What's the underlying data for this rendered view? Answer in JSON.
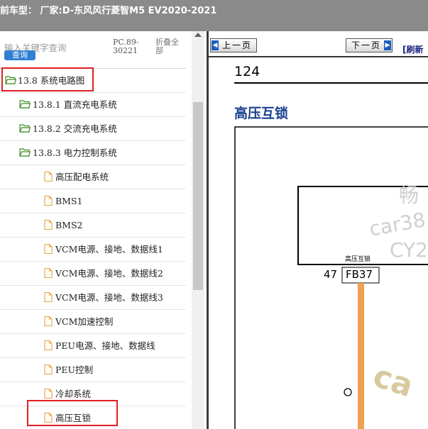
{
  "titlebar": {
    "text": "前车型：  厂家:D-东风风行菱智M5 EV2020-2021"
  },
  "sidebar": {
    "search_placeholder": "输入关键字查询",
    "search_button": "查询",
    "code_line1": "PC.89-",
    "code_line2": "30221",
    "collapse_all": "折叠全部"
  },
  "tree": [
    {
      "label": "13.8 系统电路图",
      "type": "folder"
    },
    {
      "label": "13.8.1 直流充电系统",
      "type": "folder"
    },
    {
      "label": "13.8.2 交流充电系统",
      "type": "folder"
    },
    {
      "label": "13.8.3 电力控制系统",
      "type": "folder"
    },
    {
      "label": "高压配电系统",
      "type": "file"
    },
    {
      "label": "BMS1",
      "type": "file"
    },
    {
      "label": "BMS2",
      "type": "file"
    },
    {
      "label": "VCM电源、接地、数据线1",
      "type": "file"
    },
    {
      "label": "VCM电源、接地、数据线2",
      "type": "file"
    },
    {
      "label": "VCM电源、接地、数据线3",
      "type": "file"
    },
    {
      "label": "VCM加速控制",
      "type": "file"
    },
    {
      "label": "PEU电源、接地、数据线",
      "type": "file"
    },
    {
      "label": "PEU控制",
      "type": "file"
    },
    {
      "label": "冷却系统",
      "type": "file"
    },
    {
      "label": "高压互锁",
      "type": "file"
    }
  ],
  "document": {
    "prev_button": "上一页",
    "next_button": "下一页",
    "refresh_text": "[刷新",
    "page_number": "124",
    "title": "高压互锁",
    "component_label": "高压互锁",
    "connector_code": "FB37",
    "pin_number": "47",
    "watermark_1": "畅",
    "watermark_2": "car38",
    "watermark_3": "CY2",
    "watermark_4": "ca"
  },
  "colors": {
    "folder_icon": "#3e8e28",
    "file_icon": "#e8a040",
    "highlight": "#e02020",
    "title_blue": "#1a3f8f",
    "wire_orange": "#f0a050",
    "search_button_bg": "#2f7fd3"
  }
}
